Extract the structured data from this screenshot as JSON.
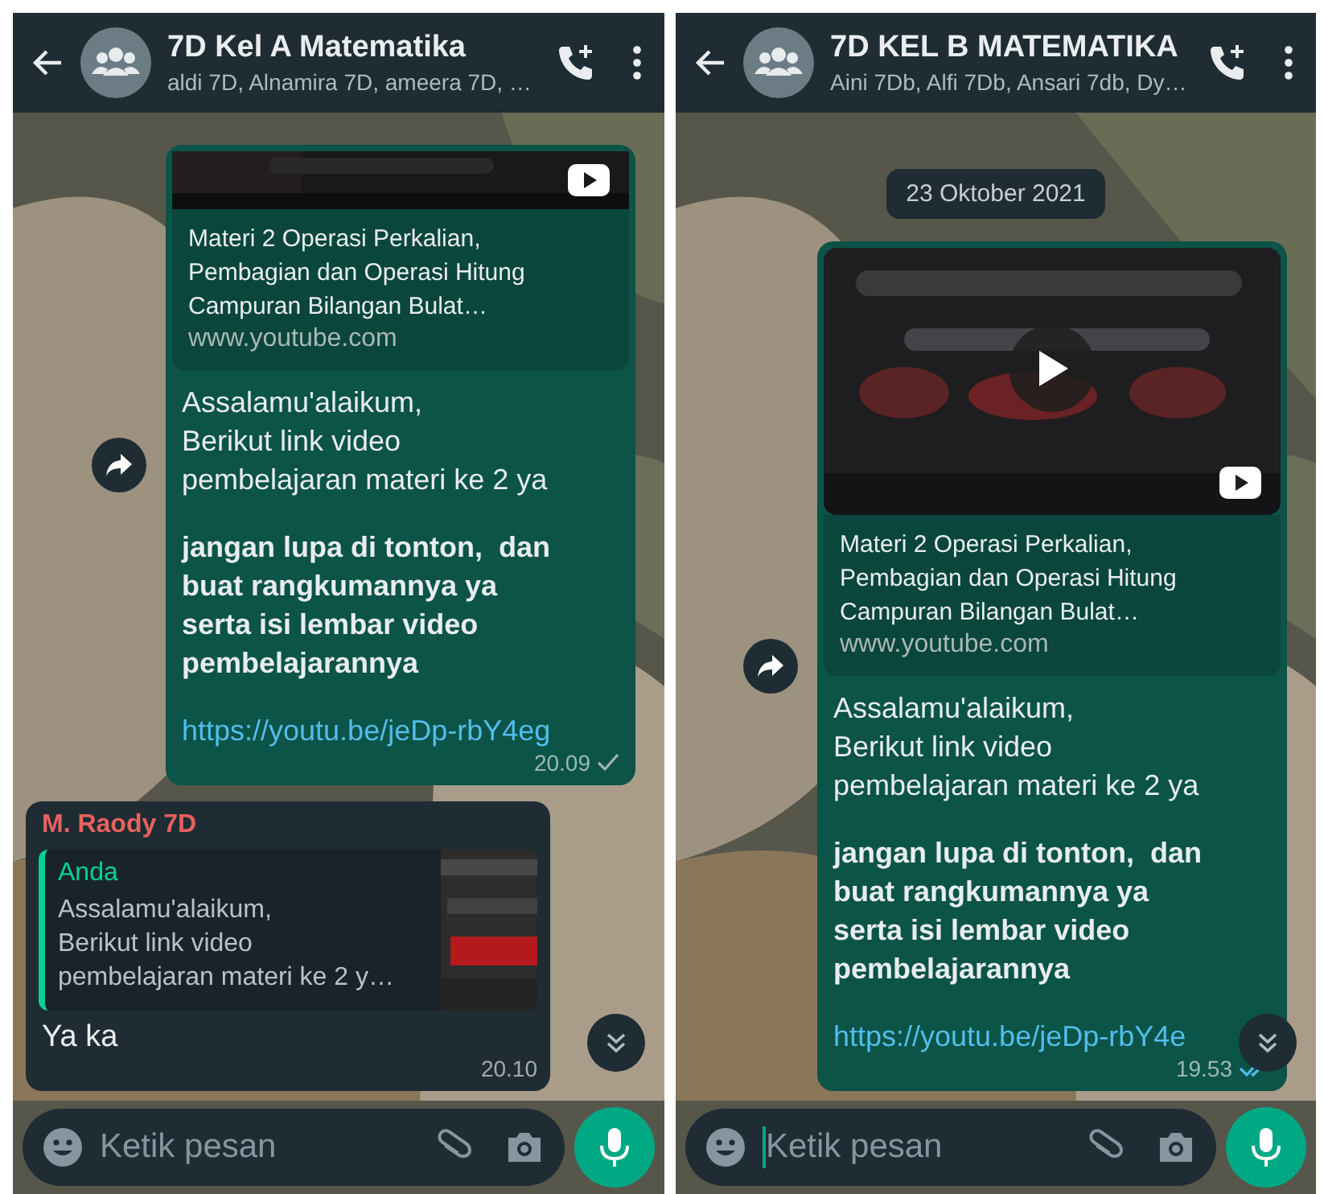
{
  "screens": [
    {
      "header": {
        "title": "7D Kel A Matematika",
        "subtitle": "aldi 7D, Alnamira 7D, ameera 7D, …"
      },
      "messages": [
        {
          "kind": "outgoing",
          "thumbnail_cropped": true,
          "forward_button": true,
          "preview_title": "Materi 2 Operasi Perkalian,\nPembagian dan Operasi Hitung\nCampuran Bilangan Bulat…",
          "preview_domain": "www.youtube.com",
          "paragraphs": [
            {
              "kind": "plain",
              "text": "Assalamu'alaikum,\nBerikut link video\npembelajaran materi ke 2 ya"
            },
            {
              "kind": "bold",
              "text": "jangan lupa di tonton,  dan\nbuat rangkumannya ya\nserta isi lembar video\npembelajarannya"
            },
            {
              "kind": "link",
              "text": "https://youtu.be/jeDp-rbY4eg"
            }
          ],
          "time": "20.09",
          "read": false
        },
        {
          "kind": "incoming",
          "sender": "M. Raody 7D",
          "color": "#e8615e",
          "quote": {
            "author": "Anda",
            "text": "Assalamu'alaikum,\nBerikut link video\npembelajaran materi ke 2 y…"
          },
          "text": "Ya ka",
          "time": "20.10"
        }
      ],
      "composer": {
        "placeholder": "Ketik pesan",
        "cursor": false
      }
    },
    {
      "header": {
        "title": "7D KEL B MATEMATIKA",
        "subtitle": "Aini 7Db, Alfi 7Db, Ansari 7db, Dy…"
      },
      "date_chip": "23 Oktober 2021",
      "messages": [
        {
          "kind": "outgoing",
          "thumbnail_cropped": false,
          "forward_button": true,
          "preview_title": "Materi 2 Operasi Perkalian,\nPembagian dan Operasi Hitung\nCampuran Bilangan Bulat…",
          "preview_domain": "www.youtube.com",
          "paragraphs": [
            {
              "kind": "plain",
              "text": "Assalamu'alaikum,\nBerikut link video\npembelajaran materi ke 2 ya"
            },
            {
              "kind": "bold",
              "text": "jangan lupa di tonton,  dan\nbuat rangkumannya ya\nserta isi lembar video\npembelajarannya"
            },
            {
              "kind": "link",
              "text": "https://youtu.be/jeDp-rbY4e"
            }
          ],
          "time": "19.53",
          "read": true
        }
      ],
      "composer": {
        "placeholder": "Ketik pesan",
        "cursor": true
      }
    }
  ]
}
